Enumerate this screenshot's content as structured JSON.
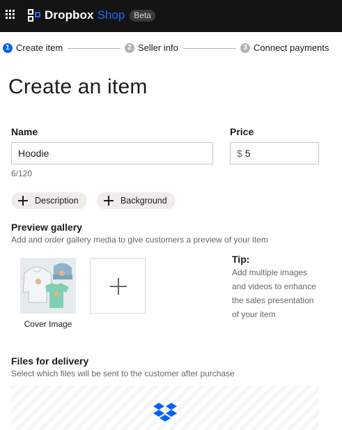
{
  "header": {
    "brand_name": "Dropbox",
    "brand_product": "Shop",
    "badge": "Beta",
    "accent_color": "#1f6bff"
  },
  "stepper": {
    "steps": [
      {
        "number": "1",
        "label": "Create item",
        "state": "active"
      },
      {
        "number": "2",
        "label": "Seller info",
        "state": "inactive"
      },
      {
        "number": "3",
        "label": "Connect payments",
        "state": "inactive"
      }
    ]
  },
  "page": {
    "title": "Create an item"
  },
  "form": {
    "name_label": "Name",
    "name_value": "Hoodie",
    "name_counter": "6/120",
    "price_label": "Price",
    "price_prefix": "$",
    "price_value": "5",
    "description_chip": "Description",
    "background_chip": "Background"
  },
  "gallery": {
    "title": "Preview gallery",
    "subtitle": "Add and order gallery media to give customers a preview of your item",
    "cover_caption": "Cover Image",
    "tip_title": "Tip:",
    "tip_body": "Add multiple images and videos to enhance the sales presentation of your item"
  },
  "delivery": {
    "title": "Files for delivery",
    "subtitle": "Select which files will be sent to the customer after purchase"
  },
  "icons": {
    "app_grid": "app-grid-icon",
    "logo": "dropbox-logo-icon",
    "plus": "plus-icon",
    "dropzone": "dropbox-box-icon"
  }
}
